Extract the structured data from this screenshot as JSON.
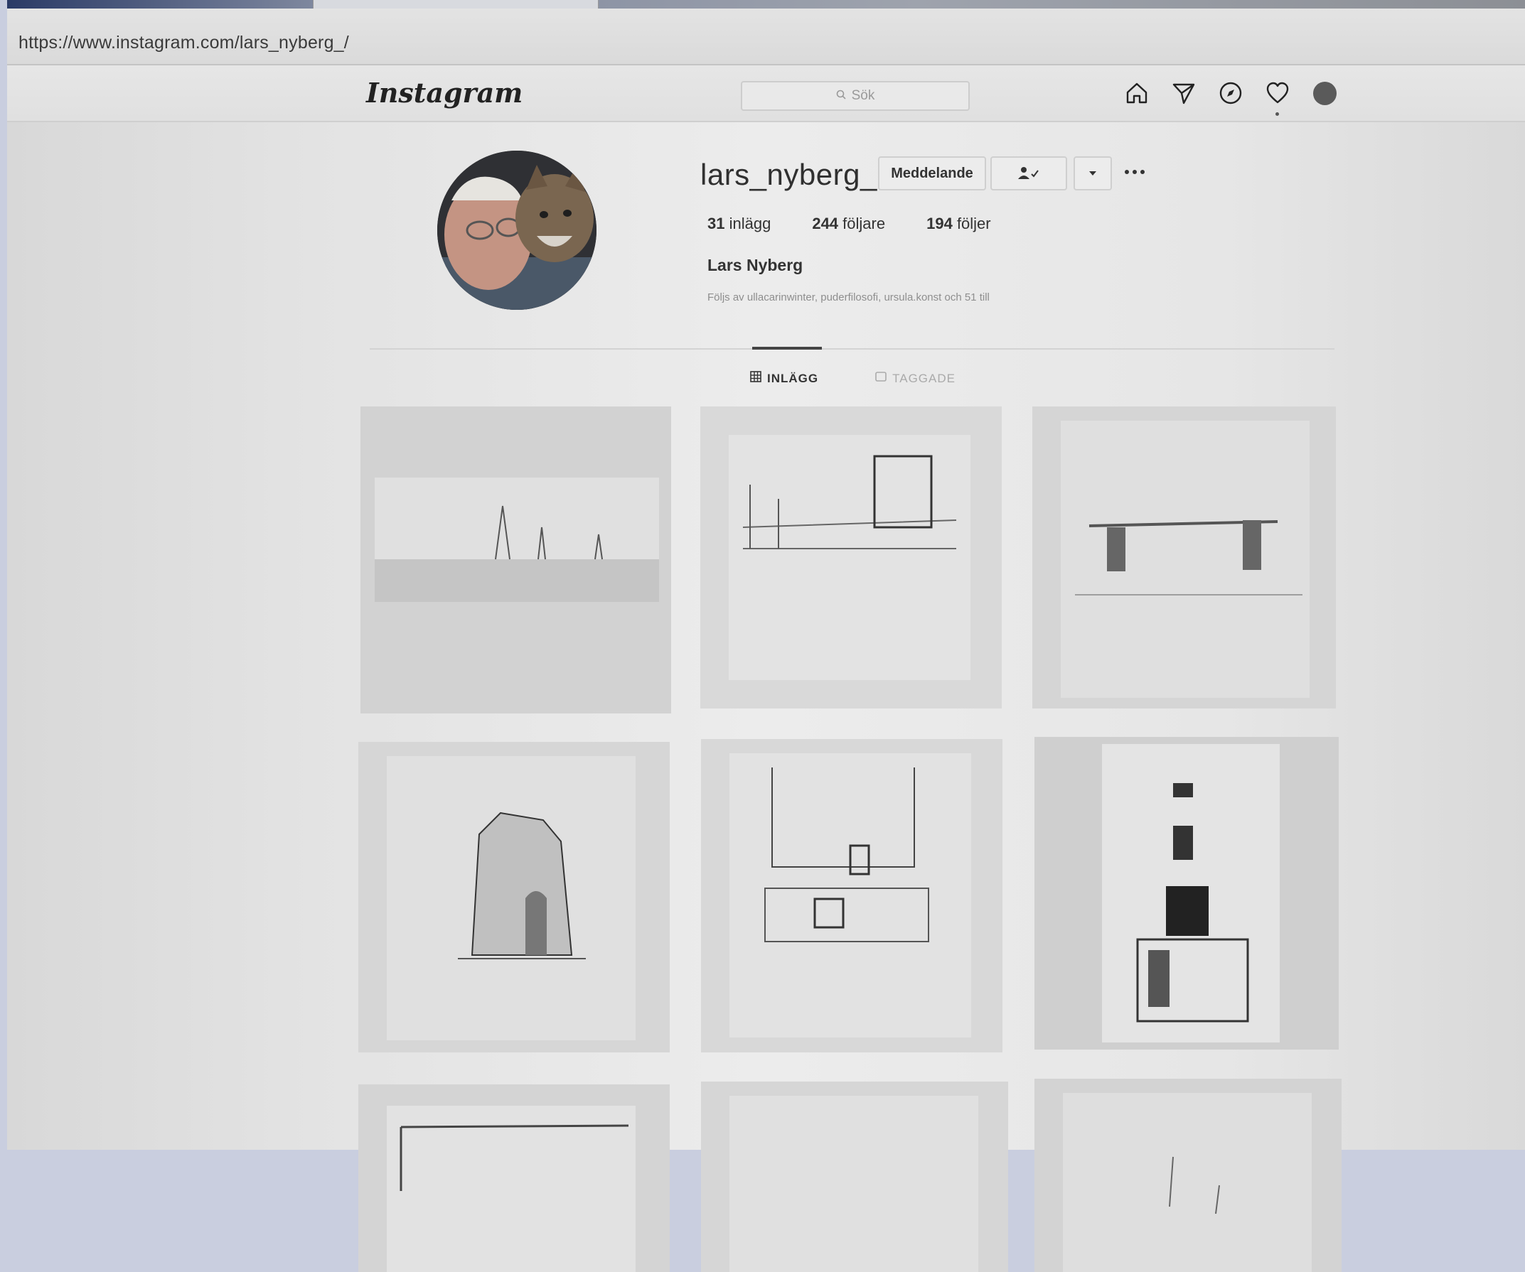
{
  "browser": {
    "url": "https://www.instagram.com/lars_nyberg_/"
  },
  "header": {
    "logo": "Instagram",
    "search_placeholder": "Sök",
    "nav_icons": [
      "home-icon",
      "direct-icon",
      "explore-icon",
      "heart-icon",
      "profile-avatar"
    ]
  },
  "profile": {
    "username": "lars_nyberg_",
    "message_button": "Meddelande",
    "stats": [
      {
        "value": "31",
        "label": "inlägg"
      },
      {
        "value": "244",
        "label": "följare"
      },
      {
        "value": "194",
        "label": "följer"
      }
    ],
    "full_name": "Lars Nyberg",
    "followed_by": "Följs av ullacarinwinter, puderfilosofi, ursula.konst och 51 till"
  },
  "tabs": [
    {
      "label": "INLÄGG",
      "active": true
    },
    {
      "label": "TAGGADE",
      "active": false
    }
  ],
  "posts": [
    {
      "subject": "shore sketch"
    },
    {
      "subject": "street perspective"
    },
    {
      "subject": "gateway"
    },
    {
      "subject": "ruined tower"
    },
    {
      "subject": "house facade"
    },
    {
      "subject": "tall building"
    },
    {
      "subject": "partial drawing"
    },
    {
      "subject": "partial drawing"
    },
    {
      "subject": "partial drawing"
    }
  ]
}
